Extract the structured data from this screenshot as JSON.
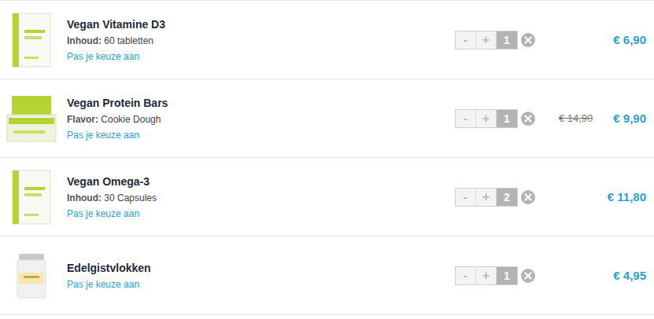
{
  "items": [
    {
      "title": "Vegan Vitamine D3",
      "option_label": "Inhoud:",
      "option_value": "60 tabletten",
      "link": "Pas je keuze aan",
      "minus": "-",
      "plus": "+",
      "qty": "1",
      "old_price": "",
      "price": "€ 6,90",
      "kind": "box"
    },
    {
      "title": "Vegan Protein Bars",
      "option_label": "Flavor:",
      "option_value": "Cookie Dough",
      "link": "Pas je keuze aan",
      "minus": "-",
      "plus": "+",
      "qty": "1",
      "old_price": "€ 14,90",
      "price": "€ 9,90",
      "kind": "bars"
    },
    {
      "title": "Vegan Omega-3",
      "option_label": "Inhoud:",
      "option_value": "30 Capsules",
      "link": "Pas je keuze aan",
      "minus": "-",
      "plus": "+",
      "qty": "2",
      "old_price": "",
      "price": "€ 11,80",
      "kind": "box"
    },
    {
      "title": "Edelgistvlokken",
      "option_label": "",
      "option_value": "",
      "link": "Pas je keuze aan",
      "minus": "-",
      "plus": "+",
      "qty": "1",
      "old_price": "",
      "price": "€ 4,95",
      "kind": "jar"
    }
  ]
}
